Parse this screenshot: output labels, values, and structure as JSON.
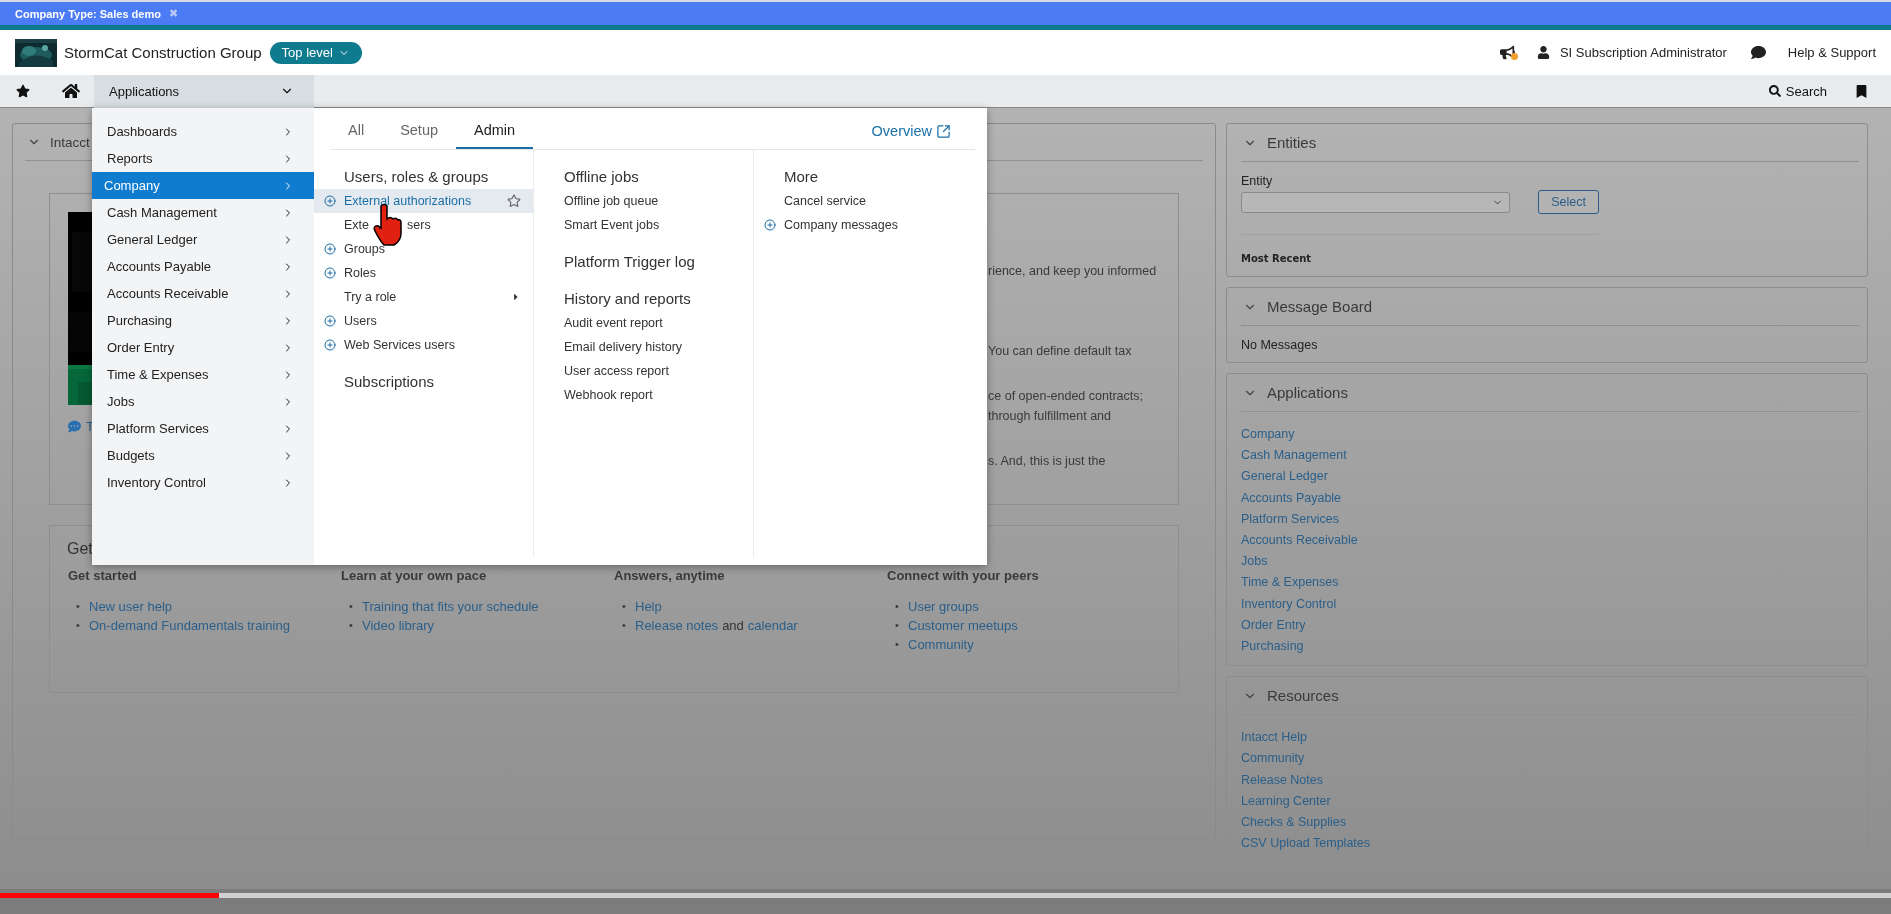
{
  "banner": {
    "text": "Company Type: Sales demo",
    "close": "✖"
  },
  "header": {
    "company": "StormCat Construction Group",
    "level_button": "Top level",
    "user": "SI Subscription Administrator",
    "help": "Help & Support"
  },
  "nav": {
    "app_menu": "Applications",
    "search": "Search"
  },
  "menu": {
    "categories": [
      {
        "label": "Dashboards",
        "selected": false
      },
      {
        "label": "Reports",
        "selected": false
      },
      {
        "label": "Company",
        "selected": true
      },
      {
        "label": "Cash Management",
        "selected": false
      },
      {
        "label": "General Ledger",
        "selected": false
      },
      {
        "label": "Accounts Payable",
        "selected": false
      },
      {
        "label": "Accounts Receivable",
        "selected": false
      },
      {
        "label": "Purchasing",
        "selected": false
      },
      {
        "label": "Order Entry",
        "selected": false
      },
      {
        "label": "Time & Expenses",
        "selected": false
      },
      {
        "label": "Jobs",
        "selected": false
      },
      {
        "label": "Platform Services",
        "selected": false
      },
      {
        "label": "Budgets",
        "selected": false
      },
      {
        "label": "Inventory Control",
        "selected": false
      }
    ],
    "tabs": [
      {
        "label": "All",
        "selected": false
      },
      {
        "label": "Setup",
        "selected": false
      },
      {
        "label": "Admin",
        "selected": true
      }
    ],
    "overview": "Overview",
    "columns": [
      [
        {
          "kind": "heading",
          "text": "Users, roles & groups"
        },
        {
          "kind": "link",
          "text": "External authorizations",
          "add": true,
          "selected": true
        },
        {
          "kind": "covered_link",
          "parts": [
            "Exte",
            "sers"
          ],
          "add": false,
          "selected": false
        },
        {
          "kind": "link",
          "text": "Groups",
          "add": true,
          "selected": false
        },
        {
          "kind": "link",
          "text": "Roles",
          "add": true,
          "selected": false
        },
        {
          "kind": "submenu",
          "text": "Try a role",
          "add": false,
          "selected": false
        },
        {
          "kind": "link",
          "text": "Users",
          "add": true,
          "selected": false
        },
        {
          "kind": "link",
          "text": "Web Services users",
          "add": true,
          "selected": false
        },
        {
          "kind": "heading",
          "text": "Subscriptions"
        }
      ],
      [
        {
          "kind": "heading",
          "text": "Offline jobs"
        },
        {
          "kind": "link",
          "text": "Offline job queue",
          "add": false,
          "selected": false
        },
        {
          "kind": "link",
          "text": "Smart Event jobs",
          "add": false,
          "selected": false
        },
        {
          "kind": "heading",
          "text": "Platform Trigger log"
        },
        {
          "kind": "heading",
          "text": "History and reports"
        },
        {
          "kind": "link",
          "text": "Audit event report",
          "add": false,
          "selected": false
        },
        {
          "kind": "link",
          "text": "Email delivery history",
          "add": false,
          "selected": false
        },
        {
          "kind": "link",
          "text": "User access report",
          "add": false,
          "selected": false
        },
        {
          "kind": "link",
          "text": "Webhook report",
          "add": false,
          "selected": false
        }
      ],
      [
        {
          "kind": "heading",
          "text": "More"
        },
        {
          "kind": "link",
          "text": "Cancel service",
          "add": false,
          "selected": false
        },
        {
          "kind": "link",
          "text": "Company messages",
          "add": true,
          "selected": false
        }
      ]
    ]
  },
  "main_panel": {
    "title": "Intacct",
    "paragraphs": [
      [
        "rience, and keep you informed"
      ],
      [
        "You can define default tax"
      ],
      [
        "ce of open-ended contracts;",
        "through fulfillment and"
      ],
      [
        "s. And, this is just the"
      ]
    ],
    "chat_link": "T",
    "get_title": "Get",
    "resource_columns": [
      {
        "heading": "Get started",
        "items": [
          {
            "marker": "•",
            "parts": [
              {
                "kind": "link",
                "text": "New user help"
              }
            ]
          },
          {
            "marker": "•",
            "parts": [
              {
                "kind": "link",
                "text": "On-demand Fundamentals training"
              }
            ]
          }
        ]
      },
      {
        "heading": "Learn at your own pace",
        "items": [
          {
            "marker": "•",
            "parts": [
              {
                "kind": "link",
                "text": "Training that fits your schedule"
              }
            ]
          },
          {
            "marker": "•",
            "parts": [
              {
                "kind": "link",
                "text": "Video library"
              }
            ]
          }
        ]
      },
      {
        "heading": "Answers, anytime",
        "items": [
          {
            "marker": "•",
            "parts": [
              {
                "kind": "link",
                "text": "Help"
              }
            ]
          },
          {
            "marker": "•",
            "parts": [
              {
                "kind": "link",
                "text": "Release notes"
              },
              {
                "kind": "text",
                "text": "and"
              },
              {
                "kind": "link",
                "text": "calendar"
              }
            ]
          }
        ]
      },
      {
        "heading": "Connect with your peers",
        "items": [
          {
            "marker": "•",
            "parts": [
              {
                "kind": "link",
                "text": "User groups"
              }
            ]
          },
          {
            "marker": "•",
            "parts": [
              {
                "kind": "link",
                "text": "Customer meetups"
              }
            ]
          },
          {
            "marker": "•",
            "parts": [
              {
                "kind": "link",
                "text": "Community"
              }
            ]
          }
        ]
      }
    ]
  },
  "side_panels": [
    {
      "kind": "entities",
      "title": "Entities",
      "field_label": "Entity",
      "button": "Select",
      "recent": "Most Recent"
    },
    {
      "kind": "message",
      "title": "Message Board",
      "text": "No Messages"
    },
    {
      "kind": "links",
      "title": "Applications",
      "links": [
        "Company",
        "Cash Management",
        "General Ledger",
        "Accounts Payable",
        "Platform Services",
        "Accounts Receivable",
        "Jobs",
        "Time & Expenses",
        "Inventory Control",
        "Order Entry",
        "Purchasing"
      ]
    },
    {
      "kind": "links",
      "title": "Resources",
      "links": [
        "Intacct Help",
        "Community",
        "Release Notes",
        "Learning Center",
        "Checks & Supplies",
        "CSV Upload Templates"
      ]
    }
  ],
  "video_progress": {
    "level": 0.116
  }
}
